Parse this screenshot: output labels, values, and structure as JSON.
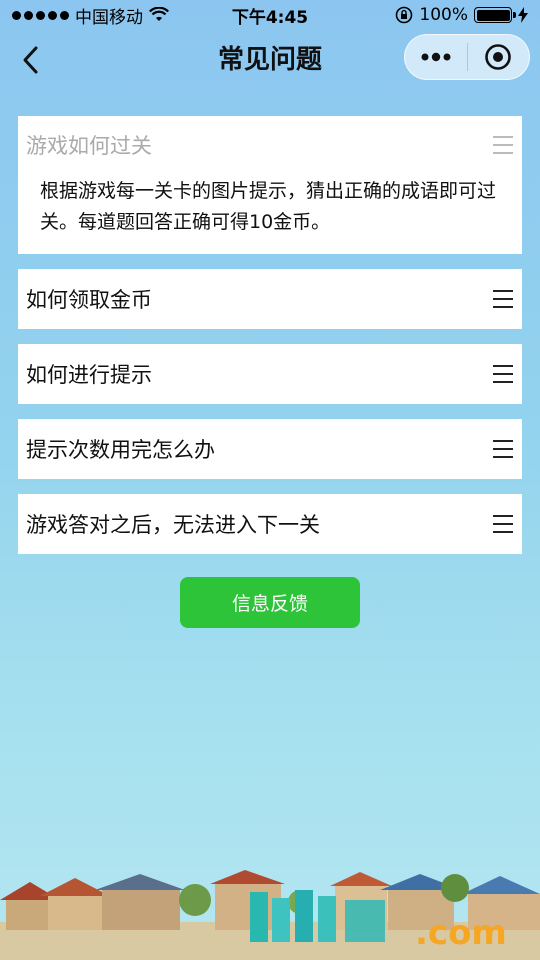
{
  "status_bar": {
    "carrier": "中国移动",
    "time": "下午4:45",
    "battery": "100%"
  },
  "nav": {
    "title": "常见问题",
    "icons": [
      "back-chevron-icon",
      "more-dots-icon",
      "close-circle-icon"
    ]
  },
  "faq": [
    {
      "question": "游戏如何过关",
      "answer": "根据游戏每一关卡的图片提示，猜出正确的成语即可过关。每道题回答正确可得10金币。",
      "expanded": true
    },
    {
      "question": "如何领取金币",
      "expanded": false
    },
    {
      "question": "如何进行提示",
      "expanded": false
    },
    {
      "question": "提示次数用完怎么办",
      "expanded": false
    },
    {
      "question": "游戏答对之后，无法进入下一关",
      "expanded": false
    }
  ],
  "feedback_button": "信息反馈",
  "watermark": "9189.com",
  "colors": {
    "accent": "#2dc43a",
    "background_top": "#8cc6f0",
    "background_bottom": "#b4e6f0"
  }
}
